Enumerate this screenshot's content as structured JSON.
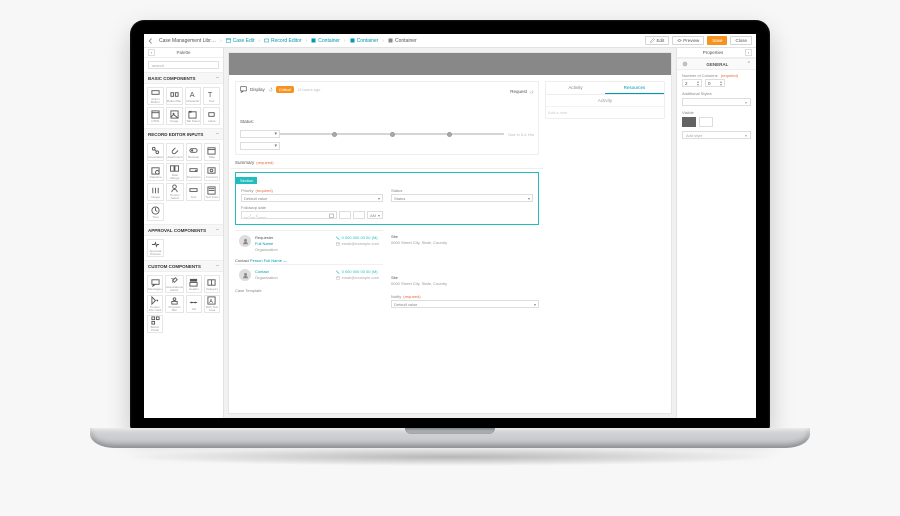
{
  "breadcrumbs": [
    {
      "label": "Case Management Libr…"
    },
    {
      "label": "Case Edit"
    },
    {
      "label": "Record Editor"
    },
    {
      "label": "Container"
    },
    {
      "label": "Container"
    },
    {
      "label": "Container"
    }
  ],
  "topbuttons": {
    "edit": "Edit",
    "preview": "Preview",
    "save": "Save",
    "close": "Close"
  },
  "palette": {
    "title": "Palette",
    "search_ph": "search",
    "sections": [
      {
        "title": "BASIC COMPONENTS",
        "tools": [
          "Action Button",
          "Button Bar",
          "Character",
          "Text",
          "HTML",
          "Image",
          "Tab Panel",
          "Label"
        ]
      },
      {
        "title": "RECORD EDITOR INPUTS",
        "tools": [
          "Association",
          "Attachment",
          "Boolean",
          "Date",
          "Datetime",
          "Date Range",
          "Dropdown",
          "Currency",
          "Integer",
          "Person Select",
          "Text",
          "Text Area",
          "Time"
        ]
      },
      {
        "title": "APPROVAL COMPONENTS",
        "tools": [
          "Approval Process"
        ]
      },
      {
        "title": "CUSTOM COMPONENTS",
        "tools": [
          "Messages",
          "Associations Editor",
          "Header",
          "Category",
          "Person Info Card",
          "Progress Bar",
          "Job",
          "Rich Text Area",
          "Button Panel"
        ]
      }
    ]
  },
  "canvas": {
    "display_label": "Display",
    "badge": "Critical",
    "time_ago": "13 hours ago",
    "request_label": "Request",
    "status_label": "Status:",
    "due_label": "Due in 0-4 Hrs",
    "summary": {
      "label": "Summary",
      "req": "(required)"
    },
    "section_tab": "Section",
    "priority": {
      "label": "Priority",
      "req": "(required)",
      "value": "Default value"
    },
    "status_field": {
      "label": "Status",
      "value": "Status"
    },
    "followup_label": "Followup date",
    "cal_mask": "__ /__ /____",
    "am": "AM",
    "contacts": {
      "requester_label": "Requester",
      "contact_label": "Contact",
      "fullname": "Full Name",
      "personname": "Person Full Name —",
      "contact2": "Contact",
      "org_label": "Organization",
      "phone": "0 000 000 00 00 (M)",
      "email": "email@example.com",
      "site_label": "Site",
      "site_value": "0000 Street City, State, Country"
    },
    "casetpl": "Case Template",
    "notify": {
      "label": "Notify",
      "req": "(required)",
      "value": "Default value"
    }
  },
  "activity": {
    "tabs": {
      "activity": "Activity",
      "resources": "Resources"
    },
    "subhead": "Activity",
    "add_note": "Add a note"
  },
  "props": {
    "title": "Properties",
    "general": "GENERAL",
    "ncols_label": "Number of Columns",
    "req": "(required)",
    "cols_a": "2",
    "cols_b": "0",
    "addl_label": "Additional Styles",
    "visible_label": "Visible",
    "addstyle": "Add style"
  }
}
